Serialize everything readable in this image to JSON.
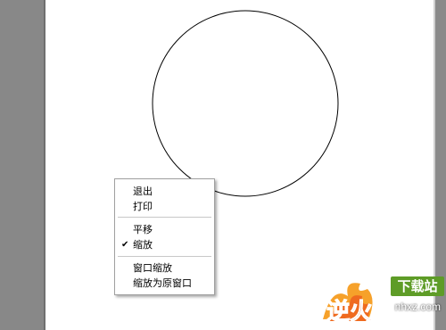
{
  "context_menu": {
    "items": [
      {
        "label": "退出",
        "checked": false
      },
      {
        "label": "打印",
        "checked": false
      },
      {
        "label": "平移",
        "checked": false
      },
      {
        "label": "缩放",
        "checked": true
      },
      {
        "label": "窗口缩放",
        "checked": false
      },
      {
        "label": "缩放为原窗口",
        "checked": false
      }
    ],
    "check_glyph": "✔"
  },
  "watermark": {
    "logo_text": "逆火",
    "brand": "下载站",
    "url": "nhxz.com"
  },
  "colors": {
    "gutter": "#888888",
    "canvas": "#ffffff",
    "brand_green": "#5e9c27",
    "logo_orange": "#ef6a1f"
  }
}
